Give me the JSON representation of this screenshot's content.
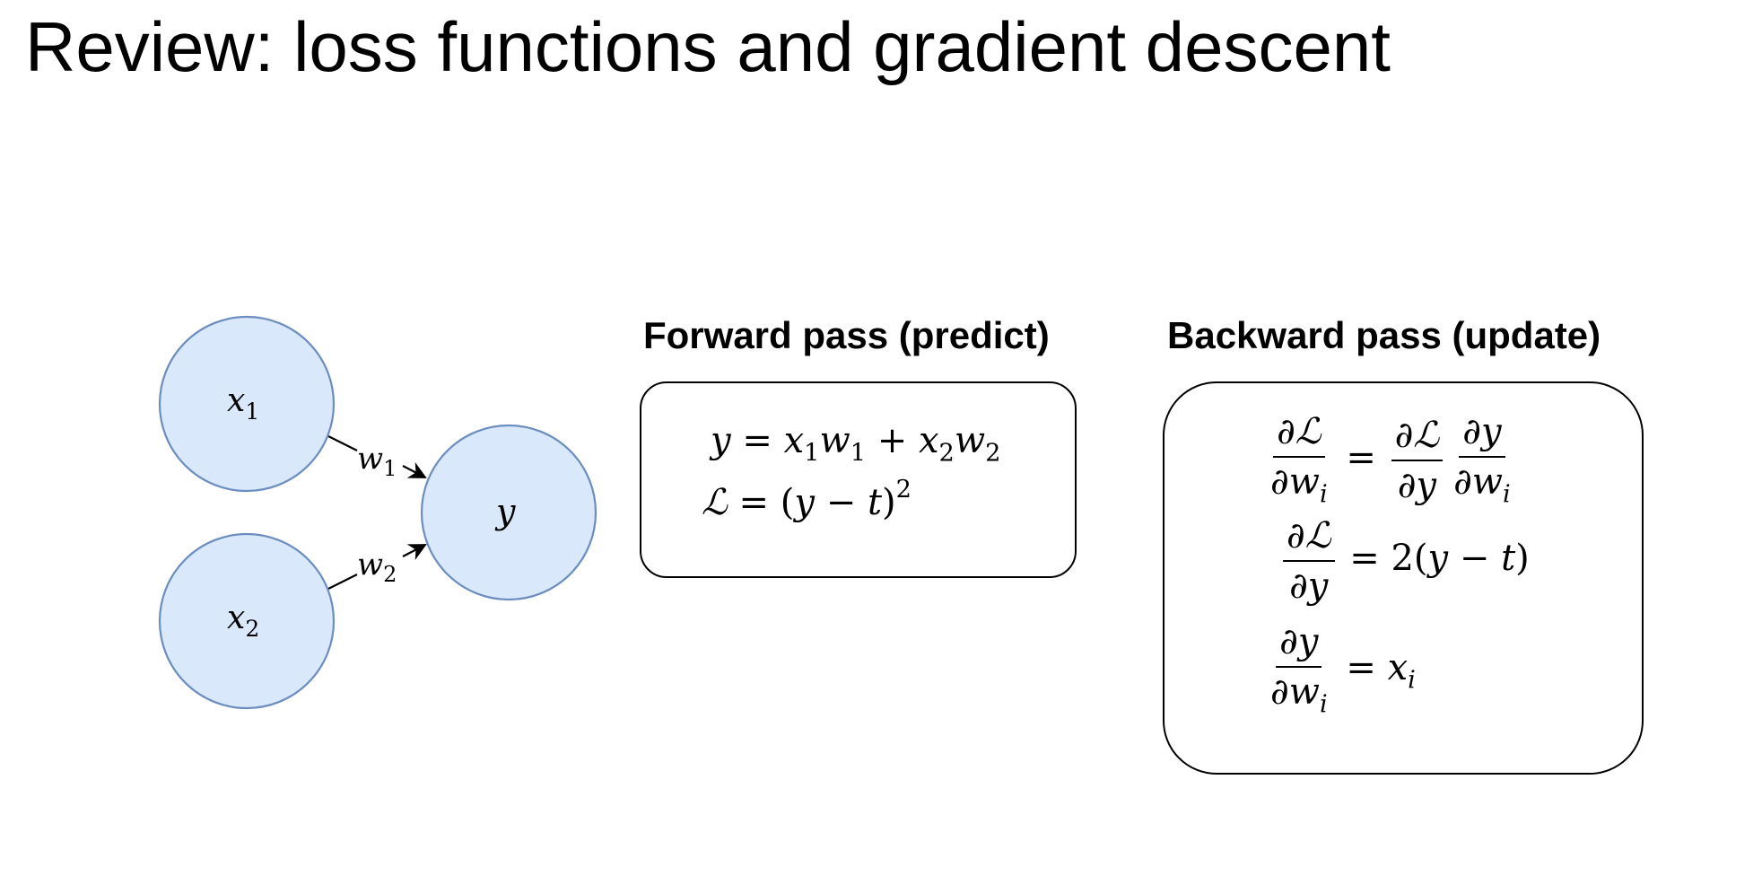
{
  "title": "Review: loss functions and gradient descent",
  "network": {
    "nodes": [
      {
        "id": "x1",
        "label": "x",
        "sub": "1"
      },
      {
        "id": "x2",
        "label": "x",
        "sub": "2"
      },
      {
        "id": "y",
        "label": "y",
        "sub": ""
      }
    ],
    "edges": [
      {
        "from": "x1",
        "to": "y",
        "label": "w",
        "sub": "1"
      },
      {
        "from": "x2",
        "to": "y",
        "label": "w",
        "sub": "2"
      }
    ],
    "node_fill": "#dae8fc",
    "node_stroke": "#6c8ebf"
  },
  "forward": {
    "heading": "Forward pass (predict)",
    "line1": "y = x1w1 + x2w2",
    "line2": "L = (y − t)^2"
  },
  "backward": {
    "heading": "Backward pass (update)",
    "eq1": "∂L/∂wi = ∂L/∂y · ∂y/∂wi",
    "eq2": "∂L/∂y = 2(y − t)",
    "eq3": "∂y/∂wi = xi"
  }
}
